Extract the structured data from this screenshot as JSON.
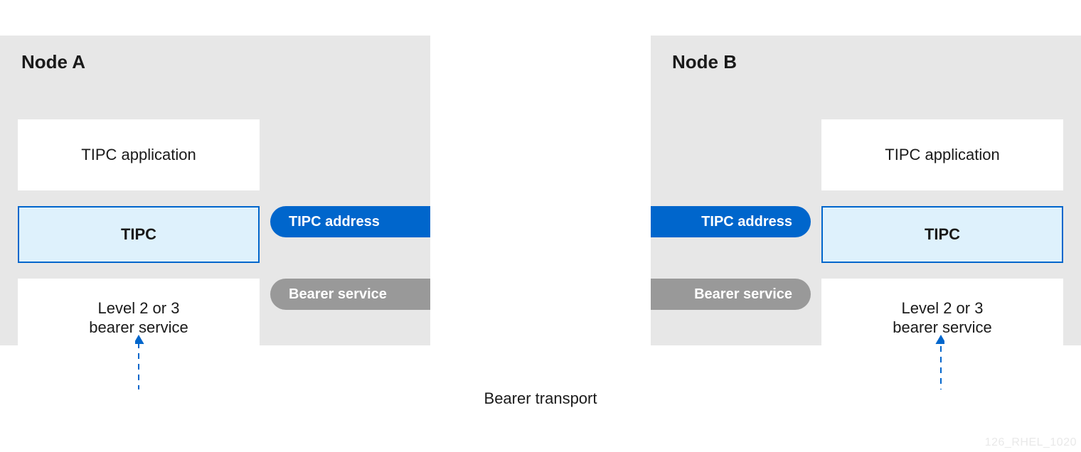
{
  "watermark": "126_RHEL_1020",
  "transport_label": "Bearer transport",
  "node_a": {
    "title": "Node A",
    "layer_app": "TIPC application",
    "layer_tipc": "TIPC",
    "layer_bearer": "Level 2 or 3\nbearer service",
    "pill_tipc_addr": "TIPC address",
    "pill_bearer": "Bearer service"
  },
  "node_b": {
    "title": "Node B",
    "layer_app": "TIPC application",
    "layer_tipc": "TIPC",
    "layer_bearer": "Level 2 or 3\nbearer service",
    "pill_tipc_addr": "TIPC address",
    "pill_bearer": "Bearer service"
  },
  "colors": {
    "accent_blue": "#06c",
    "light_blue": "#def1fc",
    "panel_gray": "#e7e7e7",
    "pill_gray": "#999999"
  }
}
